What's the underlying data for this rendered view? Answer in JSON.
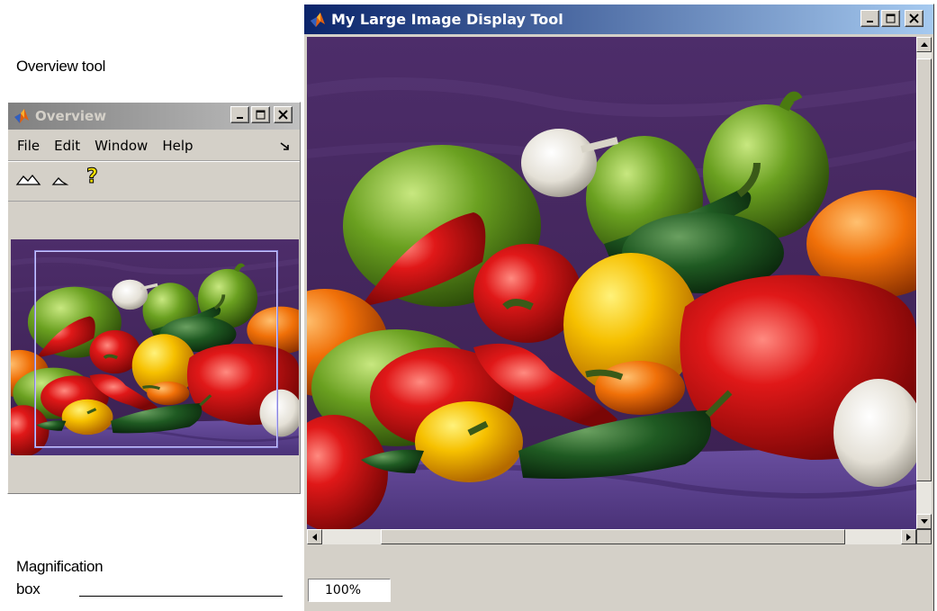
{
  "annotations": {
    "overview_tool": "Overview tool",
    "magnification_line1": "Magnification",
    "magnification_line2": "box"
  },
  "overview_window": {
    "title": "Overview",
    "menu": [
      "File",
      "Edit",
      "Window",
      "Help"
    ],
    "toolbar_icons": [
      "zoom-in-icon",
      "zoom-out-icon",
      "help-icon"
    ]
  },
  "main_window": {
    "title": "My Large Image Display Tool",
    "magnification": "100%"
  },
  "colors": {
    "active_title": "#0a246a",
    "inactive_title": "#808080",
    "chrome": "#d4d0c8",
    "background_cloth": "#4b2d66"
  }
}
